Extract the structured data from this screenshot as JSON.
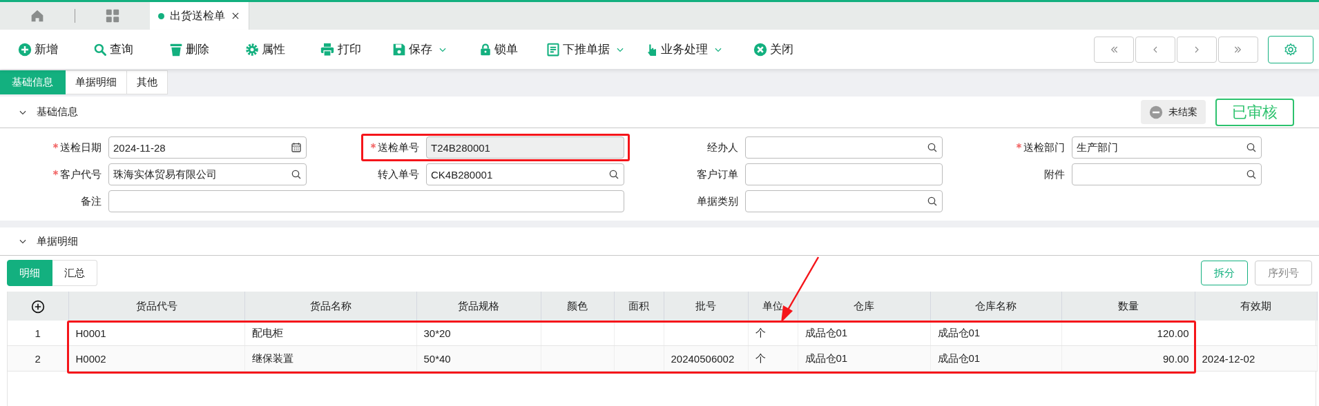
{
  "window_tabs": [
    {
      "kind": "home",
      "selected": false
    },
    {
      "kind": "apps",
      "selected": false
    },
    {
      "kind": "document",
      "label": "出货送检单",
      "selected": true
    }
  ],
  "toolbar": {
    "actions": [
      {
        "label": "新增",
        "dropdown": false
      },
      {
        "label": "查询",
        "dropdown": false
      },
      {
        "label": "删除",
        "dropdown": false
      },
      {
        "label": "属性",
        "dropdown": false
      },
      {
        "label": "打印",
        "dropdown": false
      },
      {
        "label": "保存",
        "dropdown": true
      },
      {
        "label": "锁单",
        "dropdown": false
      },
      {
        "label": "下推单据",
        "dropdown": true
      },
      {
        "label": "业务处理",
        "dropdown": true
      },
      {
        "label": "关闭",
        "dropdown": false
      }
    ]
  },
  "page_tabs": [
    {
      "label": "基础信息",
      "selected": true
    },
    {
      "label": "单据明细",
      "selected": false
    },
    {
      "label": "其他",
      "selected": false
    }
  ],
  "basic_section": {
    "title": "基础信息",
    "expanded": true,
    "status": "未结案",
    "approval": "已审核",
    "fields": [
      {
        "label": "送检日期",
        "value": "2024-11-28",
        "required": true,
        "kind": "date",
        "disabled": false,
        "highlighted": false
      },
      {
        "label": "送检单号",
        "value": "T24B280001",
        "required": true,
        "kind": "text",
        "disabled": true,
        "highlighted": true
      },
      {
        "label": "经办人",
        "required": false,
        "kind": "lookup",
        "disabled": false,
        "highlighted": false
      },
      {
        "label": "送检部门",
        "value": "生产部门",
        "required": true,
        "kind": "lookup",
        "disabled": false,
        "highlighted": false
      },
      {
        "label": "客户代号",
        "value": "珠海实体贸易有限公司",
        "required": true,
        "kind": "lookup",
        "disabled": false,
        "highlighted": false
      },
      {
        "label": "转入单号",
        "value": "CK4B280001",
        "required": false,
        "kind": "lookup",
        "disabled": false,
        "highlighted": false
      },
      {
        "label": "客户订单",
        "required": false,
        "kind": "text",
        "disabled": false,
        "highlighted": false
      },
      {
        "label": "附件",
        "required": false,
        "kind": "lookup",
        "disabled": false,
        "highlighted": false
      },
      {
        "label": "备注",
        "required": false,
        "kind": "textarea",
        "disabled": false,
        "highlighted": false
      },
      {
        "label": "单据类别",
        "required": false,
        "kind": "lookup",
        "disabled": false,
        "highlighted": false
      }
    ]
  },
  "detail_section": {
    "title": "单据明细",
    "expanded": true,
    "tabs": [
      {
        "label": "明细",
        "selected": true
      },
      {
        "label": "汇总",
        "selected": false
      }
    ],
    "buttons": [
      {
        "label": "拆分",
        "kind": "primary"
      },
      {
        "label": "序列号",
        "kind": "default"
      }
    ],
    "table": {
      "highlight": true,
      "highlight_arrow": true,
      "columns": [
        {
          "kind": "add"
        },
        {
          "label": "货品代号"
        },
        {
          "label": "货品名称"
        },
        {
          "label": "货品规格"
        },
        {
          "label": "颜色"
        },
        {
          "label": "面积"
        },
        {
          "label": "批号"
        },
        {
          "label": "单位"
        },
        {
          "label": "仓库"
        },
        {
          "label": "仓库名称"
        },
        {
          "label": "数量"
        },
        {
          "label": "有效期"
        }
      ],
      "rows": [
        [
          "1",
          "H0001",
          "配电柜",
          "30*20",
          null,
          null,
          null,
          "个",
          "成品仓01",
          "成品仓01",
          "120.00",
          null
        ],
        [
          "2",
          "H0002",
          "继保装置",
          "50*40",
          null,
          null,
          "20240506002",
          "个",
          "成品仓01",
          "成品仓01",
          "90.00",
          "2024-12-02"
        ]
      ]
    }
  }
}
